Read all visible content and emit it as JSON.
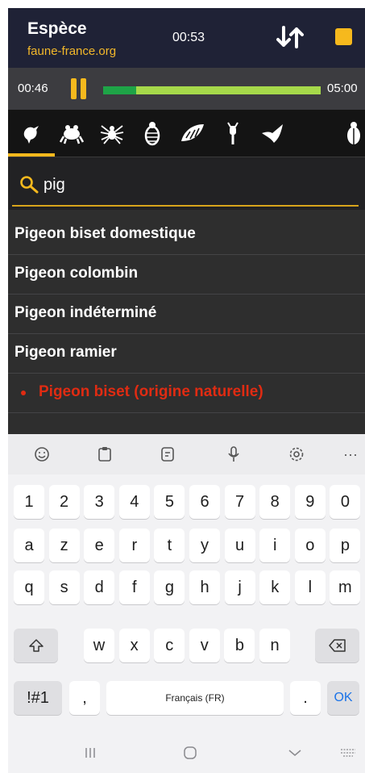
{
  "app": {
    "title": "Espèce",
    "subtitle": "faune-france.org",
    "timer": "00:53"
  },
  "recording": {
    "elapsed": "00:46",
    "total": "05:00",
    "progress_fraction": 0.153
  },
  "taxa": [
    "bird-icon",
    "frog-icon",
    "spider-icon",
    "fly-icon",
    "mollusc-icon",
    "dragonfly-icon",
    "bat-icon",
    "beetle-icon"
  ],
  "search": {
    "value": "pig"
  },
  "results": [
    {
      "label": "Pigeon biset domestique",
      "highlight": false
    },
    {
      "label": "Pigeon colombin",
      "highlight": false
    },
    {
      "label": "Pigeon indéterminé",
      "highlight": false
    },
    {
      "label": "Pigeon ramier",
      "highlight": false
    },
    {
      "label": "Pigeon biset (origine naturelle)",
      "highlight": true
    }
  ],
  "keyboard": {
    "toolbar": [
      "emoji-icon",
      "clipboard-icon",
      "sticker-icon",
      "mic-icon",
      "settings-icon",
      "more-icon"
    ],
    "more_label": "···",
    "numbers": [
      "1",
      "2",
      "3",
      "4",
      "5",
      "6",
      "7",
      "8",
      "9",
      "0"
    ],
    "row1": [
      "a",
      "z",
      "e",
      "r",
      "t",
      "y",
      "u",
      "i",
      "o",
      "p"
    ],
    "row2": [
      "q",
      "s",
      "d",
      "f",
      "g",
      "h",
      "j",
      "k",
      "l",
      "m"
    ],
    "row3": [
      "w",
      "x",
      "c",
      "v",
      "b",
      "n"
    ],
    "symbols_label": "!#1",
    "comma_label": ",",
    "space_label": "Français (FR)",
    "period_label": ".",
    "ok_label": "OK"
  },
  "colors": {
    "accent": "#f6b91d",
    "highlight_red": "#e02b12",
    "appbar": "#1f2236"
  }
}
